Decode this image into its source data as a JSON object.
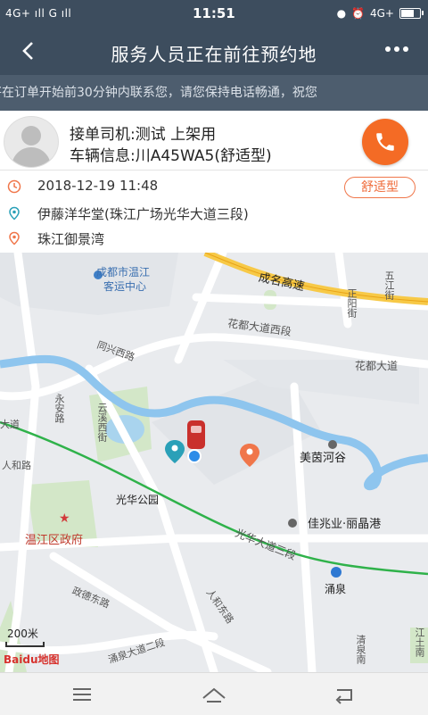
{
  "status_bar": {
    "left": "4G+ ıll G ıll",
    "time": "11:51",
    "right": "4G+"
  },
  "header": {
    "back_icon": "chevron-left-icon",
    "title": "服务人员正在前往预约地",
    "more_icon": "more-dots-icon"
  },
  "notice": "将在订单开始前30分钟内联系您，请您保持电话畅通，祝您",
  "driver": {
    "name_line": "接单司机:测试 上架用",
    "vehicle_line": "车辆信息:川A45WA5(舒适型)",
    "call_icon": "phone-icon",
    "call_color": "#f46b25"
  },
  "order": {
    "time": "2018-12-19 11:48",
    "badge": "舒适型",
    "pickup": "伊藤洋华堂(珠江广场光华大道三段)",
    "destination": "珠江御景湾"
  },
  "map": {
    "labels": {
      "bus_station_1": "成都市温江",
      "bus_station_2": "客运中心",
      "highway": "成名高速",
      "huadu_west": "花都大道西段",
      "huadu_east": "花都大道",
      "tongxing": "同兴西路",
      "yunxi": "云溪西街",
      "yongan": "永安路",
      "meiyin": "美茵河谷",
      "guanghua_park": "光华公园",
      "jiazhaoye": "佳兆业·丽晶港",
      "government": "温江区政府",
      "guanghua_road": "光华大道三段",
      "yongquan": "涌泉",
      "zhenghe": "政德东路",
      "renhe_road": "人和路",
      "renhe_road2": "人和东路",
      "yongquan_road": "涌泉大道二段",
      "zhengyang": "正阳街",
      "wujiang": "五江街",
      "qingquan": "清泉南",
      "hemao": "和路",
      "dadao": "大道",
      "scale": "200米",
      "baidu": "Baidu地图",
      "jiangshi": "江土南"
    }
  },
  "nav_buttons": {
    "menu_icon": "menu-icon",
    "home_icon": "home-icon",
    "back_icon": "return-icon"
  }
}
